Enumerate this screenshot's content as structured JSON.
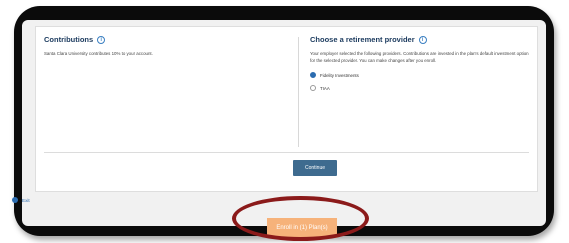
{
  "contributions": {
    "title": "Contributions",
    "text": "Santa Clara University contributes 10% to your account."
  },
  "provider": {
    "title": "Choose a retirement provider",
    "text": "Your employer selected the following providers. Contributions are invested in the plan's default investment option for the selected provider. You can make changes after you enroll.",
    "options": [
      {
        "label": "Fidelity Investments",
        "selected": true
      },
      {
        "label": "TIAA",
        "selected": false
      }
    ]
  },
  "buttons": {
    "continue": "Continue",
    "enroll": "Enroll in (1) Plan(s)",
    "exit": "Exit"
  },
  "colors": {
    "accent": "#2b6cb0",
    "continue_bg": "#3e6b8f",
    "enroll_bg": "#f6b27a",
    "highlight": "#8b1a1a"
  }
}
